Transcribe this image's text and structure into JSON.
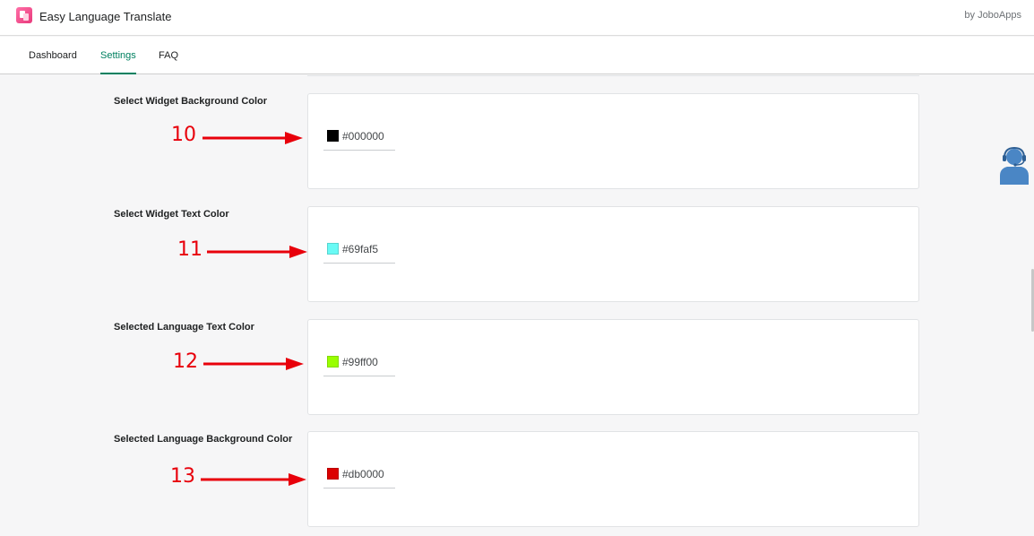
{
  "app": {
    "title": "Easy Language Translate",
    "byline": "by JoboApps"
  },
  "nav": {
    "tabs": [
      {
        "label": "Dashboard",
        "active": false
      },
      {
        "label": "Settings",
        "active": true
      },
      {
        "label": "FAQ",
        "active": false
      }
    ]
  },
  "settings": [
    {
      "label": "Select Widget Background Color",
      "value": "#000000",
      "swatch": "#000000",
      "marker": "10"
    },
    {
      "label": "Select Widget Text Color",
      "value": "#69faf5",
      "swatch": "#69faf5",
      "marker": "11"
    },
    {
      "label": "Selected Language Text Color",
      "value": "#99ff00",
      "swatch": "#99ff00",
      "marker": "12"
    },
    {
      "label": "Selected Language Background Color",
      "value": "#db0000",
      "swatch": "#db0000",
      "marker": "13"
    }
  ],
  "colors": {
    "accent": "#008060",
    "annotation": "#e8000b",
    "support_icon": "#4a86c5"
  },
  "icons": {
    "app_logo": "translate-app-icon",
    "support": "customer-support-agent-icon"
  }
}
